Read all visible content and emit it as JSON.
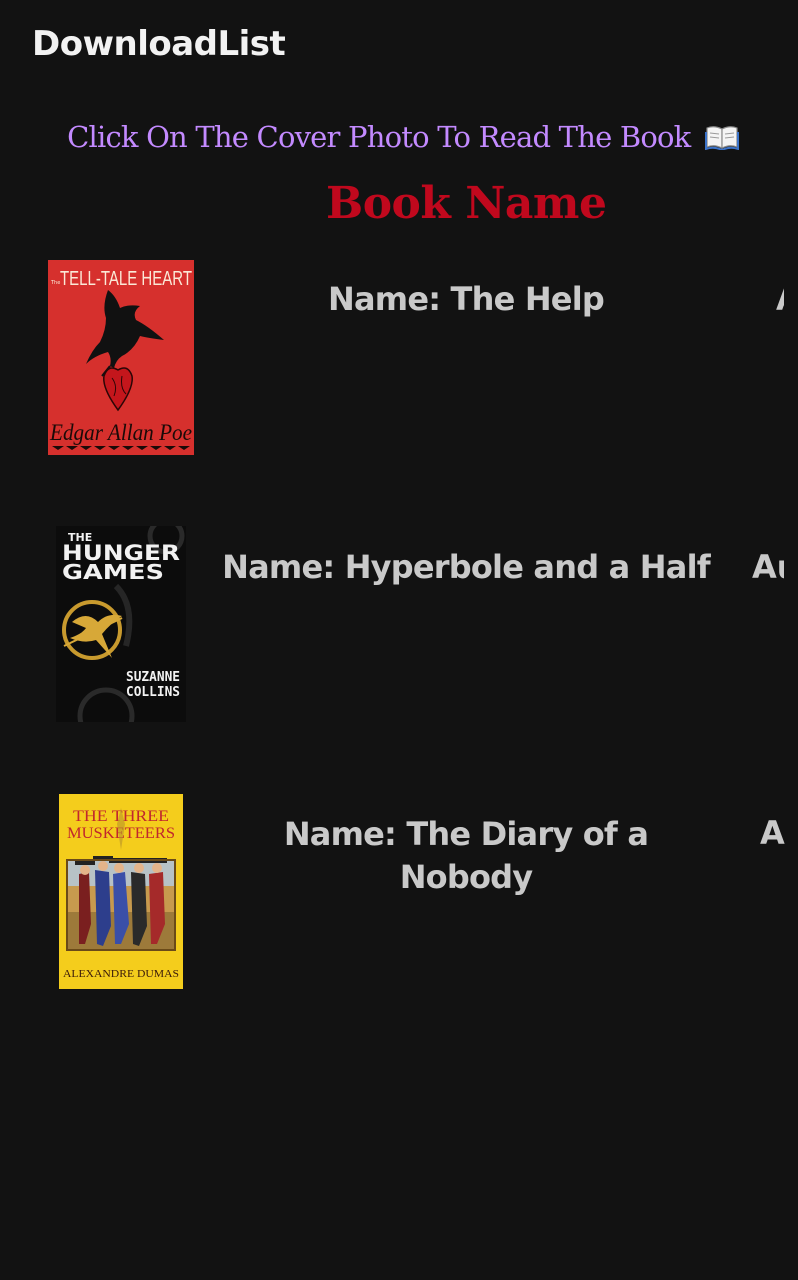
{
  "app": {
    "title": "DownloadList"
  },
  "instruction": {
    "text": "Click On The Cover Photo To Read The Book",
    "icon": "open-book-icon",
    "color": "#c38aff"
  },
  "column_header": {
    "text": "Book Name",
    "color": "#c0081d"
  },
  "books": [
    {
      "name": "Name: The Help",
      "author_visible": "A",
      "cover": {
        "title_text": "TELL-TALE HEART",
        "title_prefix": "The",
        "author_text": "Edgar Allan Poe",
        "background": "#d6302d",
        "icon": "raven-heart-icon"
      }
    },
    {
      "name": "Name: Hyperbole and a Half",
      "author_visible": "Au",
      "cover": {
        "title_top": "THE",
        "title_main": "HUNGER",
        "title_sub": "GAMES",
        "author_line1": "SUZANNE",
        "author_line2": "COLLINS",
        "background": "#0c0c0c",
        "icon": "mockingjay-pin-icon"
      }
    },
    {
      "name": "Name: The Diary of a Nobody",
      "author_visible": "A",
      "cover": {
        "title_line1": "THE THREE",
        "title_line2": "MUSKETEERS",
        "author_text": "ALEXANDRE DUMAS",
        "background": "#f4cd1c",
        "icon": "musketeers-illustration-icon"
      }
    }
  ]
}
